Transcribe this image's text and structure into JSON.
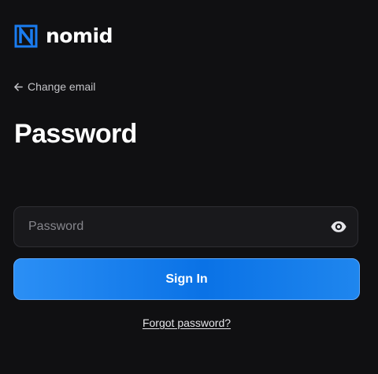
{
  "brand": {
    "name": "nomid",
    "accent_color": "#1a7cf0",
    "logo_icon": "nomid-logo-icon"
  },
  "nav": {
    "back_label": "Change email",
    "back_icon": "arrow-left-icon"
  },
  "page": {
    "title": "Password"
  },
  "form": {
    "password": {
      "value": "",
      "placeholder": "Password",
      "toggle_icon": "eye-icon"
    },
    "submit_label": "Sign In",
    "forgot_label": "Forgot password?"
  },
  "colors": {
    "background": "#101012",
    "field_background": "#19191c",
    "button_gradient_start": "#2b8ff5",
    "button_gradient_end": "#0a72e6"
  }
}
